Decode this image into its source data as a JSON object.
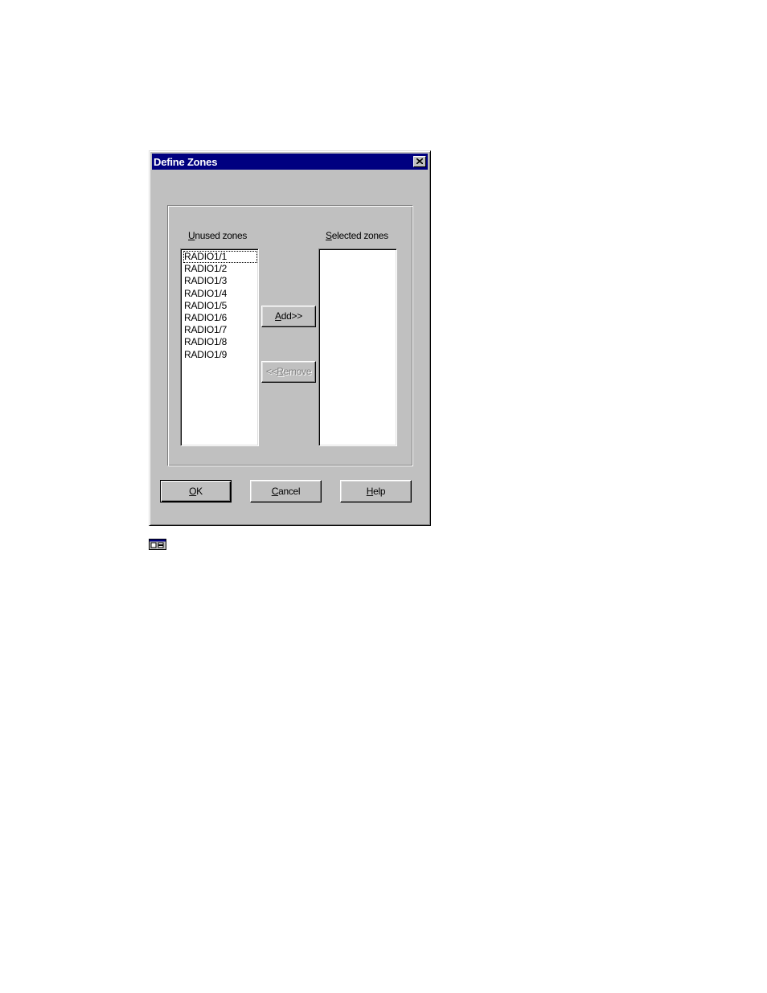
{
  "dialog": {
    "title": "Define Zones",
    "close_icon": "close-icon"
  },
  "unused": {
    "label_accel": "U",
    "label_rest": "nused zones",
    "items": [
      "RADIO1/1",
      "RADIO1/2",
      "RADIO1/3",
      "RADIO1/4",
      "RADIO1/5",
      "RADIO1/6",
      "RADIO1/7",
      "RADIO1/8",
      "RADIO1/9"
    ]
  },
  "selected": {
    "label_accel": "S",
    "label_rest": "elected zones",
    "items": []
  },
  "buttons": {
    "add_accel": "A",
    "add_rest": "dd>>",
    "remove_pre": "<<",
    "remove_accel": "R",
    "remove_rest": "emove",
    "ok_accel": "O",
    "ok_rest": "K",
    "cancel_accel": "C",
    "cancel_rest": "ancel",
    "help_accel": "H",
    "help_rest": "elp"
  },
  "icons": {
    "window_icon": "dialog-window-icon"
  }
}
